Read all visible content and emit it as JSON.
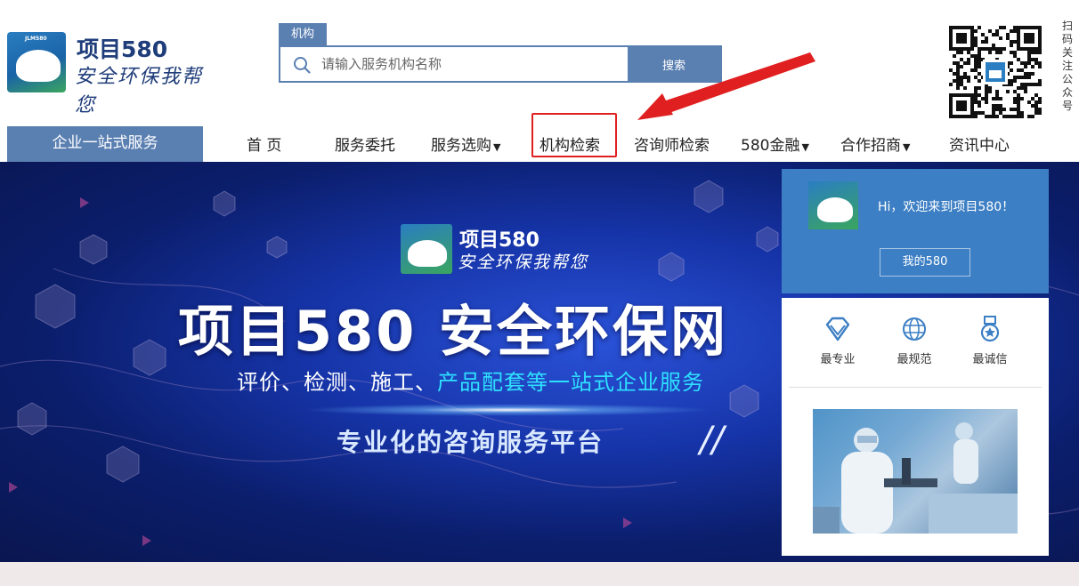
{
  "header": {
    "logo_title": "项目580",
    "logo_slogan": "安全环保我帮您",
    "logo_mark_text": "JLM580",
    "search": {
      "tab_label": "机构",
      "placeholder": "请输入服务机构名称",
      "value": "",
      "button_label": "搜索"
    },
    "qr_label": "扫码关注公众号"
  },
  "nav": {
    "service_tab": "企业一站式服务",
    "items": [
      {
        "label": "首 页",
        "caret": false
      },
      {
        "label": "服务委托",
        "caret": false
      },
      {
        "label": "服务选购",
        "caret": true
      },
      {
        "label": "机构检索",
        "caret": false
      },
      {
        "label": "咨询师检索",
        "caret": false
      },
      {
        "label": "580金融",
        "caret": true
      },
      {
        "label": "合作招商",
        "caret": true
      },
      {
        "label": "资讯中心",
        "caret": false
      }
    ]
  },
  "banner": {
    "logo_title": "项目580",
    "logo_slogan": "安全环保我帮您",
    "logo_mark_text": "JLM580",
    "headline": "项目580 安全环保网",
    "subtitle_pre": "评价、检测、施工、",
    "subtitle_highlight": "产品配套等一站式企业服务",
    "tagline": "专业化的咨询服务平台",
    "slash": "//"
  },
  "panel": {
    "welcome": "Hi，欢迎来到项目580！",
    "my_button": "我的580",
    "features": [
      {
        "label": "最专业",
        "icon": "diamond-icon"
      },
      {
        "label": "最规范",
        "icon": "globe-icon"
      },
      {
        "label": "最诚信",
        "icon": "medal-icon"
      }
    ]
  },
  "colors": {
    "brand_blue": "#5a7fb1",
    "panel_blue": "#3d7fc4",
    "annotation_red": "#e02020",
    "highlight_cyan": "#2ee0ff"
  }
}
